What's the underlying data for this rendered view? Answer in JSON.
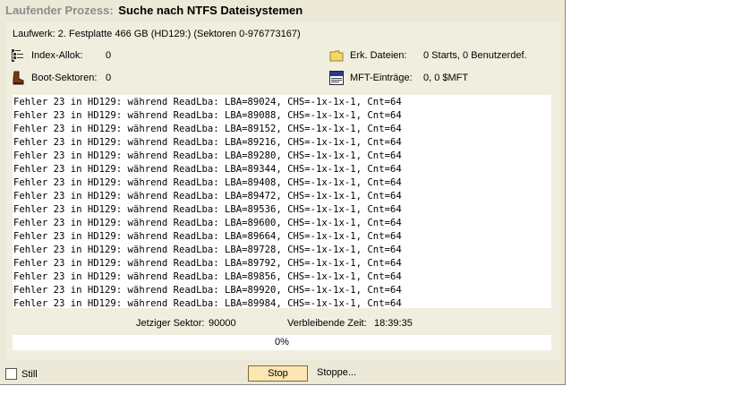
{
  "title": {
    "label": "Laufender Prozess:",
    "name": "Suche nach NTFS Dateisystemen"
  },
  "drive": {
    "text": "Laufwerk: 2. Festplatte 466 GB (HD129:) (Sektoren 0-976773167)"
  },
  "stats": {
    "index_alloc": {
      "label": "Index-Allok:",
      "value": "0",
      "icon": "index-allocation-icon"
    },
    "boot_sectors": {
      "label": "Boot-Sektoren:",
      "value": "0",
      "icon": "boot-icon"
    },
    "found_files": {
      "label": "Erk. Dateien:",
      "value": "0 Starts, 0 Benutzerdef.",
      "icon": "folder-icon"
    },
    "mft_entries": {
      "label": "MFT-Einträge:",
      "value": "0, 0 $MFT",
      "icon": "file-icon"
    }
  },
  "log": [
    "Fehler 23 in HD129: während ReadLba: LBA=89024, CHS=-1x-1x-1, Cnt=64",
    "Fehler 23 in HD129: während ReadLba: LBA=89088, CHS=-1x-1x-1, Cnt=64",
    "Fehler 23 in HD129: während ReadLba: LBA=89152, CHS=-1x-1x-1, Cnt=64",
    "Fehler 23 in HD129: während ReadLba: LBA=89216, CHS=-1x-1x-1, Cnt=64",
    "Fehler 23 in HD129: während ReadLba: LBA=89280, CHS=-1x-1x-1, Cnt=64",
    "Fehler 23 in HD129: während ReadLba: LBA=89344, CHS=-1x-1x-1, Cnt=64",
    "Fehler 23 in HD129: während ReadLba: LBA=89408, CHS=-1x-1x-1, Cnt=64",
    "Fehler 23 in HD129: während ReadLba: LBA=89472, CHS=-1x-1x-1, Cnt=64",
    "Fehler 23 in HD129: während ReadLba: LBA=89536, CHS=-1x-1x-1, Cnt=64",
    "Fehler 23 in HD129: während ReadLba: LBA=89600, CHS=-1x-1x-1, Cnt=64",
    "Fehler 23 in HD129: während ReadLba: LBA=89664, CHS=-1x-1x-1, Cnt=64",
    "Fehler 23 in HD129: während ReadLba: LBA=89728, CHS=-1x-1x-1, Cnt=64",
    "Fehler 23 in HD129: während ReadLba: LBA=89792, CHS=-1x-1x-1, Cnt=64",
    "Fehler 23 in HD129: während ReadLba: LBA=89856, CHS=-1x-1x-1, Cnt=64",
    "Fehler 23 in HD129: während ReadLba: LBA=89920, CHS=-1x-1x-1, Cnt=64",
    "Fehler 23 in HD129: während ReadLba: LBA=89984, CHS=-1x-1x-1, Cnt=64"
  ],
  "status": {
    "current_sector_label": "Jetziger Sektor:",
    "current_sector_value": "90000",
    "remaining_label": "Verbleibende Zeit:",
    "remaining_value": "18:39:35"
  },
  "progress": {
    "text": "0%",
    "fraction": 0
  },
  "footer": {
    "still_label": "Still",
    "still_checked": false,
    "stop_label": "Stop",
    "stop_status": "Stoppe..."
  }
}
